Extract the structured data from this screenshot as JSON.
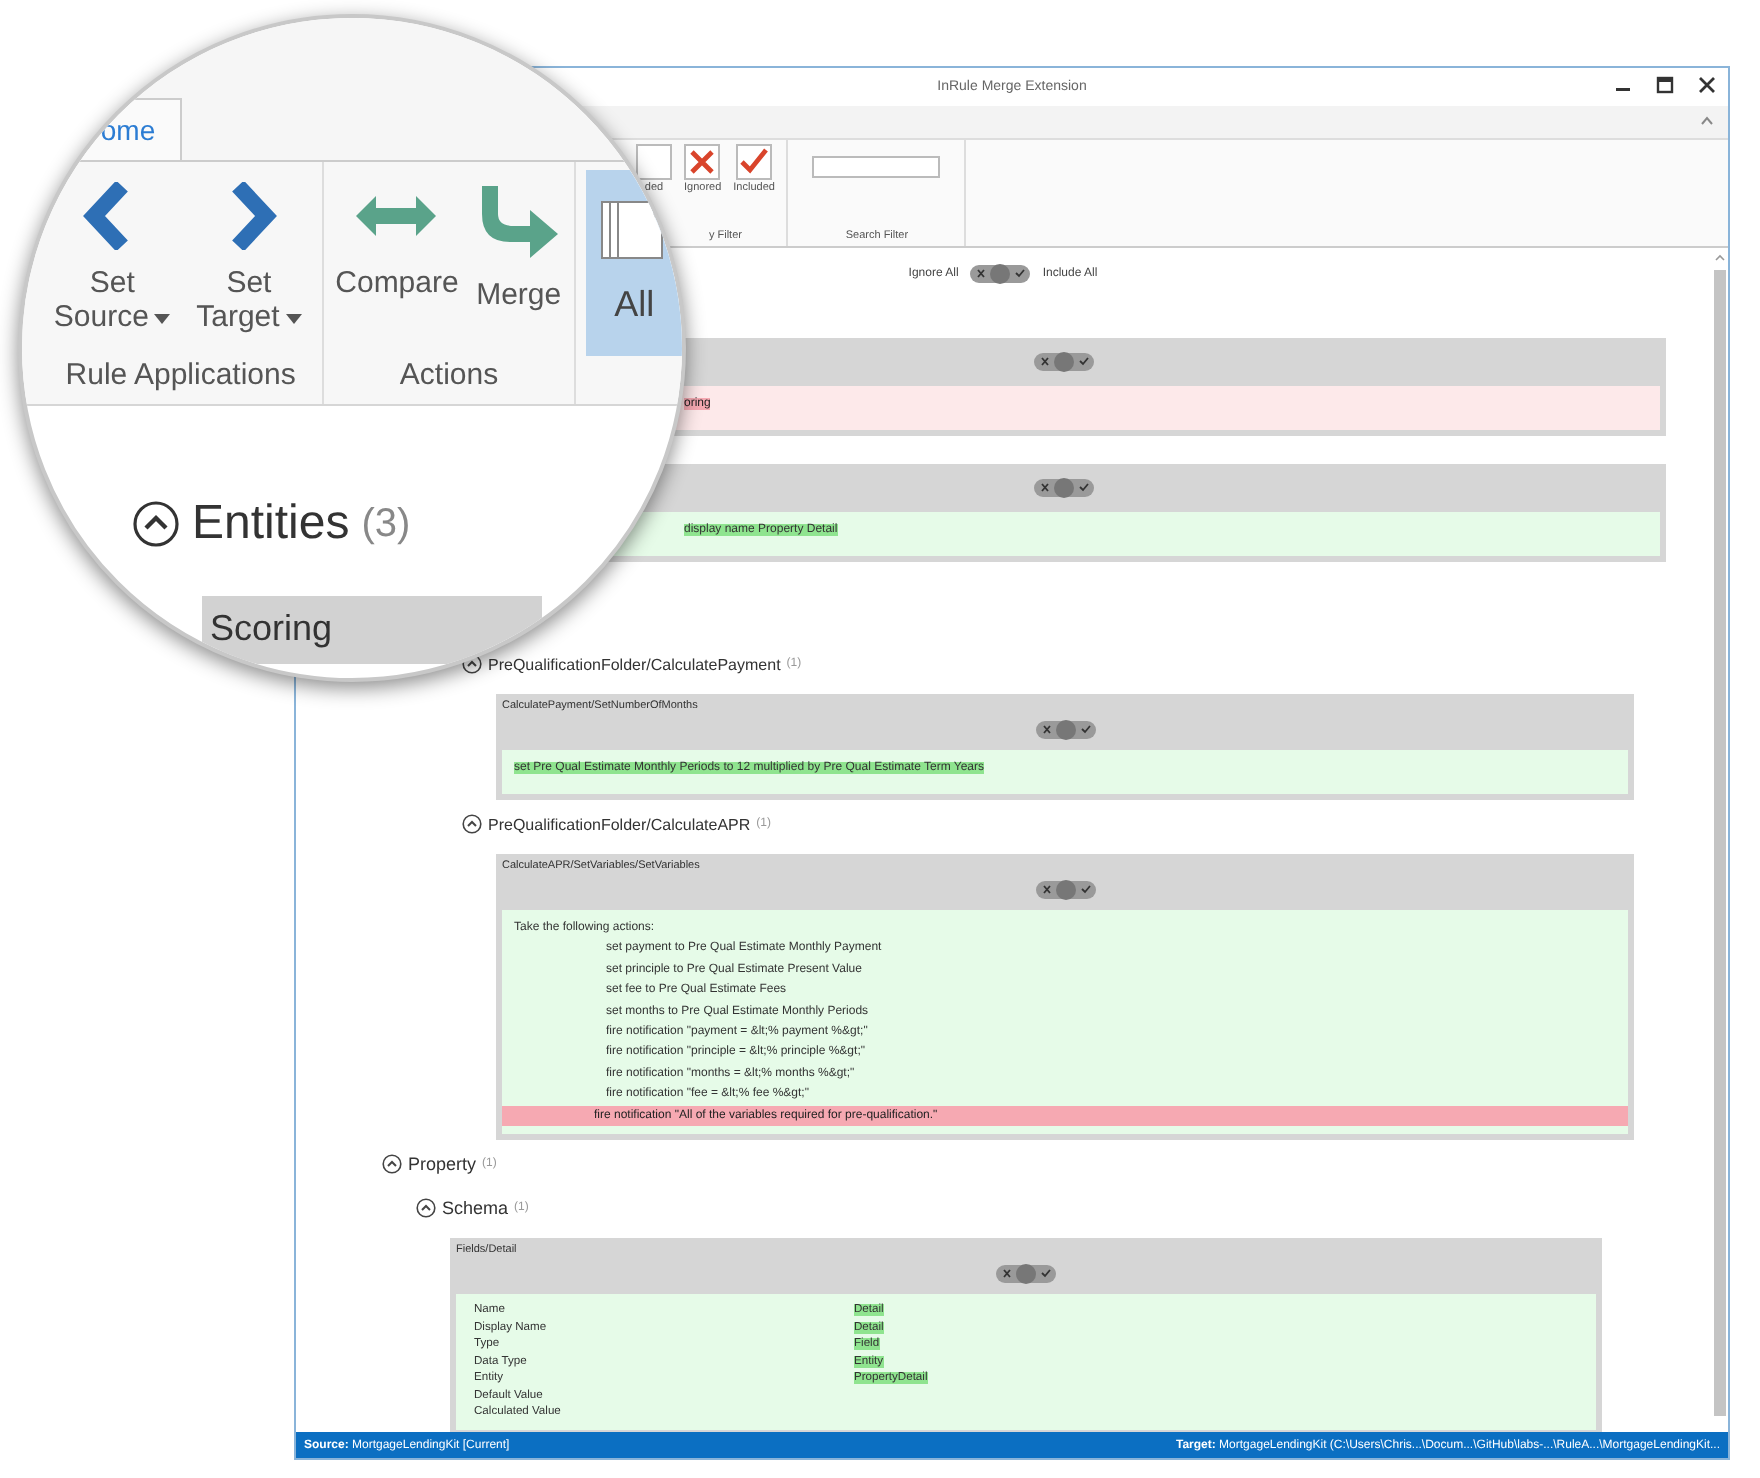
{
  "window": {
    "title": "InRule Merge Extension"
  },
  "magnifier": {
    "tab": "ome",
    "groups": [
      {
        "label": "Rule Applications",
        "buttons": [
          {
            "label": "Set Source",
            "dropdown": true
          },
          {
            "label": "Set Target",
            "dropdown": true
          }
        ]
      },
      {
        "label": "Actions",
        "buttons": [
          {
            "label": "Compare",
            "dropdown": false
          },
          {
            "label": "Merge",
            "dropdown": false
          }
        ]
      }
    ],
    "all_button": {
      "label": "All",
      "selected": true
    },
    "entities": {
      "label": "Entities",
      "count": "(3)",
      "expanded": true
    },
    "entity": "Scoring"
  },
  "ribbon": {
    "filters": [
      {
        "label": "ded",
        "kind": "empty"
      },
      {
        "label": "Ignored",
        "kind": "cross"
      },
      {
        "label": "Included",
        "kind": "check"
      }
    ],
    "filter_group": "y Filter",
    "search_group": "Search Filter"
  },
  "bulk": {
    "ignore_label": "Ignore All",
    "include_label": "Include All",
    "ignored": false,
    "included": false
  },
  "tree": [
    {
      "kind": "group",
      "children": [
        {
          "kind": "card",
          "removed": true,
          "ignored": false,
          "included": false,
          "lines": [
            {
              "text": "oring",
              "highlighted": true,
              "removed": true,
              "indented": false
            }
          ]
        },
        {
          "kind": "card",
          "removed": false,
          "ignored": false,
          "included": false,
          "lines": [
            {
              "text": "display name Property Detail",
              "highlighted": true,
              "removed": false,
              "indented": false
            }
          ]
        },
        {
          "kind": "node",
          "label": "PreQualificationFolder/CalculatePayment",
          "count": "(1)",
          "expanded": true,
          "children": [
            {
              "kind": "card",
              "removed": false,
              "ignored": false,
              "included": false,
              "title": "CalculatePayment/SetNumberOfMonths",
              "lines": [
                {
                  "text": "set Pre Qual Estimate Monthly Periods to 12 multiplied by Pre Qual Estimate Term Years",
                  "highlighted": true,
                  "removed": false,
                  "indented": false
                }
              ]
            }
          ]
        },
        {
          "kind": "node",
          "label": "PreQualificationFolder/CalculateAPR",
          "count": "(1)",
          "expanded": true,
          "children": [
            {
              "kind": "card",
              "removed": false,
              "ignored": false,
              "included": false,
              "title": "CalculateAPR/SetVariables/SetVariables",
              "lines": [
                {
                  "text": "Take the following actions:",
                  "highlighted": false,
                  "removed": false,
                  "indented": false
                },
                {
                  "text": "set payment to Pre Qual Estimate Monthly Payment",
                  "highlighted": false,
                  "removed": false,
                  "indented": true
                },
                {
                  "text": "set principle to Pre Qual Estimate Present Value",
                  "highlighted": false,
                  "removed": false,
                  "indented": true
                },
                {
                  "text": "set fee to Pre Qual Estimate Fees",
                  "highlighted": false,
                  "removed": false,
                  "indented": true
                },
                {
                  "text": "set months to Pre Qual Estimate Monthly Periods",
                  "highlighted": false,
                  "removed": false,
                  "indented": true
                },
                {
                  "text": "fire notification \"payment = &lt;% payment %&gt;\"",
                  "highlighted": false,
                  "removed": false,
                  "indented": true
                },
                {
                  "text": "fire notification \"principle = &lt;% principle %&gt;\"",
                  "highlighted": false,
                  "removed": false,
                  "indented": true
                },
                {
                  "text": "fire notification \"months = &lt;% months %&gt;\"",
                  "highlighted": false,
                  "removed": false,
                  "indented": true
                },
                {
                  "text": "fire notification \"fee = &lt;% fee %&gt;\"",
                  "highlighted": false,
                  "removed": false,
                  "indented": true
                },
                {
                  "text": "fire notification \"All of the variables required for pre-qualification.\"",
                  "highlighted": true,
                  "removed": true,
                  "indented": true
                }
              ]
            }
          ]
        }
      ]
    },
    {
      "kind": "node",
      "label": "Property",
      "count": "(1)",
      "expanded": true,
      "children": [
        {
          "kind": "node",
          "label": "Schema",
          "count": "(1)",
          "expanded": true,
          "children": [
            {
              "kind": "card",
              "removed": false,
              "ignored": false,
              "included": false,
              "title": "Fields/Detail",
              "fields": [
                {
                  "name": "Name",
                  "value": "Detail"
                },
                {
                  "name": "Display Name",
                  "value": "Detail"
                },
                {
                  "name": "Type",
                  "value": "Field"
                },
                {
                  "name": "Data Type",
                  "value": "Entity"
                },
                {
                  "name": "Entity",
                  "value": "PropertyDetail"
                },
                {
                  "name": "Default Value"
                },
                {
                  "name": "Calculated Value"
                }
              ]
            }
          ]
        }
      ]
    }
  ],
  "status_bar": {
    "source": "**Source:** MortgageLendingKit [Current]",
    "target": "**Target:** MortgageLendingKit (C:\\Users\\Chris...\\Docum...\\GitHub\\labs-...\\RuleA...\\MortgageLendingKit..."
  }
}
